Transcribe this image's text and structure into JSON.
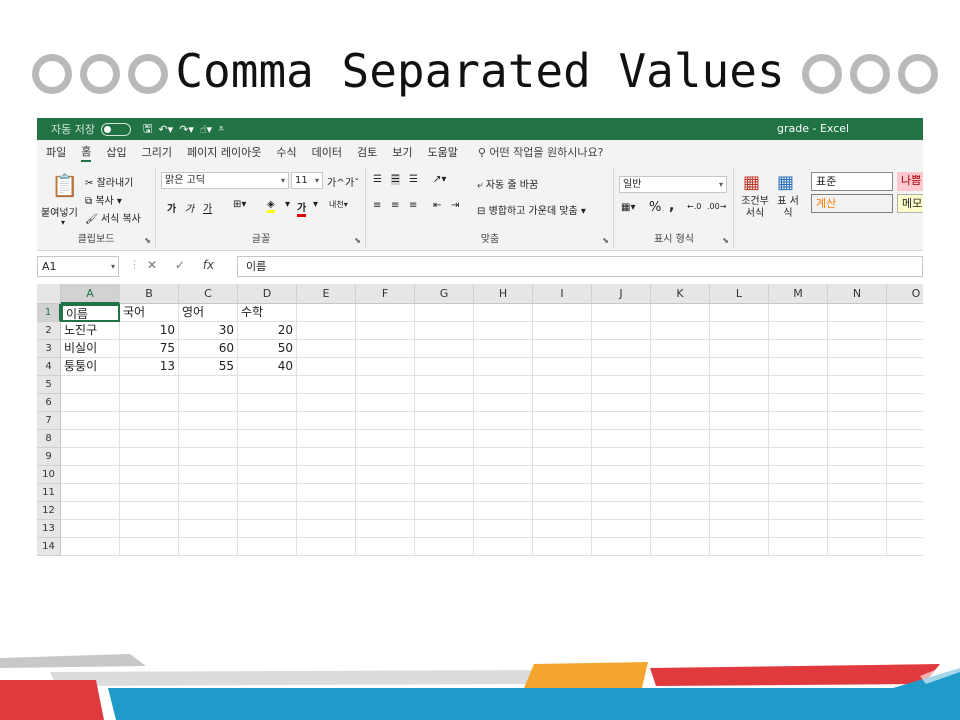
{
  "slide": {
    "title": "Comma Separated Values"
  },
  "excel": {
    "qat": {
      "autosave_label": "자동 저장",
      "toggle_state": "끔"
    },
    "window_title": "grade  -  Excel",
    "menu": [
      "파일",
      "홈",
      "삽입",
      "그리기",
      "페이지 레이아웃",
      "수식",
      "데이터",
      "검토",
      "보기",
      "도움말"
    ],
    "tell_me": "어떤 작업을 원하시나요?",
    "ribbon": {
      "clipboard": {
        "paste": "붙여넣기",
        "cut": "잘라내기",
        "copy": "복사",
        "format_painter": "서식 복사",
        "label": "클립보드"
      },
      "font": {
        "name": "맑은 고딕",
        "size": "11",
        "grow": "가^",
        "shrink": "가ˇ",
        "bold": "가",
        "italic": "가",
        "underline": "가",
        "font_color": "가",
        "label": "글꼴"
      },
      "alignment": {
        "wrap": "자동 줄 바꿈",
        "merge": "병합하고 가운데 맞춤",
        "label": "맞춤"
      },
      "number": {
        "format": "일반",
        "percent": "%",
        "comma": ",",
        "label": "표시 형식"
      },
      "styles": {
        "conditional": "조건부 서식",
        "table": "표 서식",
        "normal": "표준",
        "bad": "나쁨",
        "calculation": "계산",
        "note": "메모"
      }
    },
    "name_box": "A1",
    "formula": "이름",
    "columns": [
      "A",
      "B",
      "C",
      "D",
      "E",
      "F",
      "G",
      "H",
      "I",
      "J",
      "K",
      "L",
      "M",
      "N",
      "O"
    ],
    "rows": [
      "1",
      "2",
      "3",
      "4",
      "5",
      "6",
      "7",
      "8",
      "9",
      "10",
      "11",
      "12",
      "13",
      "14"
    ],
    "cells": {
      "A1": "이름",
      "B1": "국어",
      "C1": "영어",
      "D1": "수학",
      "A2": "노진구",
      "B2": "10",
      "C2": "30",
      "D2": "20",
      "A3": "비실이",
      "B3": "75",
      "C3": "60",
      "D3": "50",
      "A4": "퉁퉁이",
      "B4": "13",
      "C4": "55",
      "D4": "40"
    }
  },
  "colors": {
    "excel_green": "#217346",
    "ring_gray": "#b9b9b9",
    "deco_red": "#e03a3e",
    "deco_orange": "#f3a530",
    "deco_blue": "#1f9ac9",
    "deco_gray": "#c8c8c8"
  }
}
